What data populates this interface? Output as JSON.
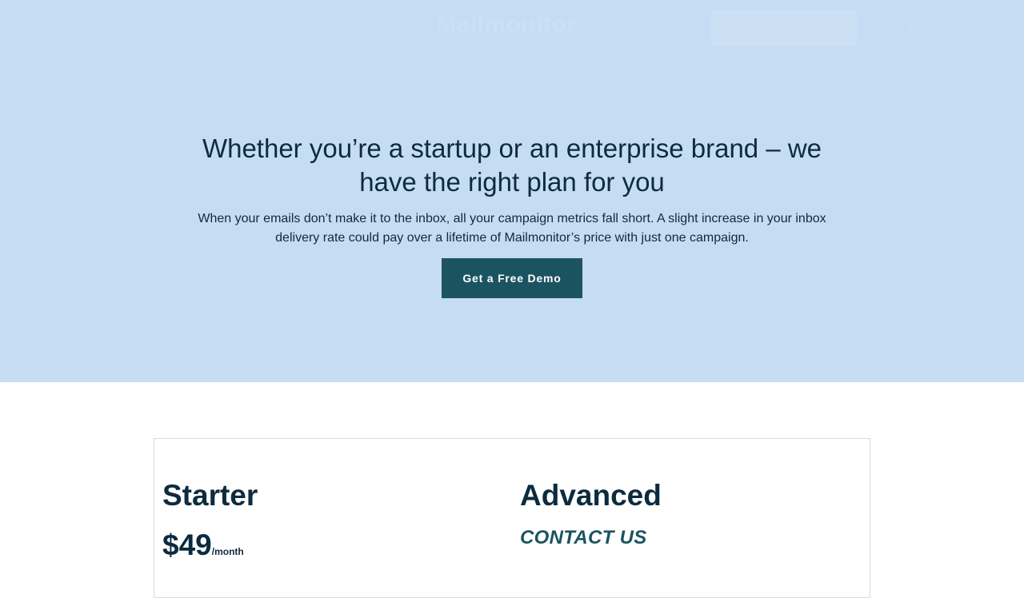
{
  "header": {
    "logo_text": "Mailmonitor",
    "cta_label": "",
    "menu_icon": "menu-icon"
  },
  "hero": {
    "title": "Whether you’re a startup or an enterprise brand – we have the right plan for you",
    "subtitle": "When your emails don’t make it to the inbox, all your campaign metrics fall short. A slight increase in your inbox delivery rate could pay over a lifetime of Mailmonitor’s price with just one campaign.",
    "button_label": "Get a Free Demo"
  },
  "plans": [
    {
      "name": "Starter",
      "price": "$49",
      "period": "/month"
    },
    {
      "name": "Advanced",
      "contact_label": "CONTACT US"
    }
  ],
  "colors": {
    "hero_bg": "#c5dcf2",
    "primary": "#1b5460",
    "text": "#0d2b3e"
  }
}
